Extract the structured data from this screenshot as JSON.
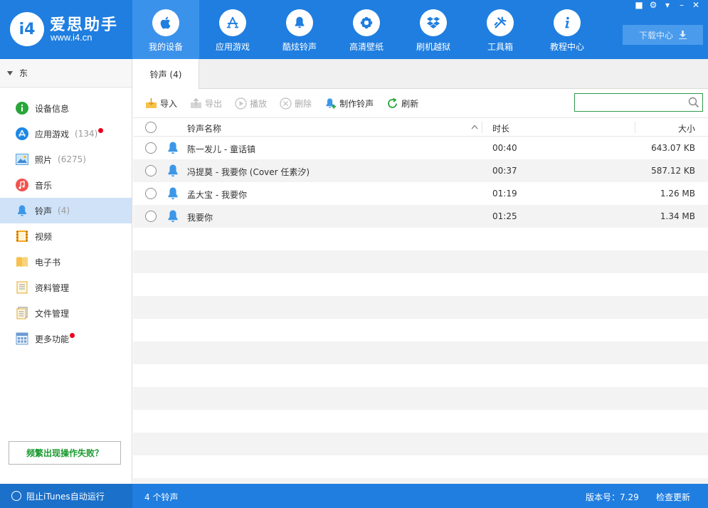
{
  "app": {
    "name": "爱思助手",
    "url": "www.i4.cn",
    "logo_text": "i4"
  },
  "nav": [
    {
      "label": "我的设备",
      "icon": "apple-icon"
    },
    {
      "label": "应用游戏",
      "icon": "appstore-icon"
    },
    {
      "label": "酷炫铃声",
      "icon": "bell-icon"
    },
    {
      "label": "高清壁纸",
      "icon": "flower-icon"
    },
    {
      "label": "刷机越狱",
      "icon": "dropbox-icon"
    },
    {
      "label": "工具箱",
      "icon": "tools-icon"
    },
    {
      "label": "教程中心",
      "icon": "info-icon"
    }
  ],
  "download_center": "下载中心",
  "sidebar": {
    "device_name": "东",
    "items": [
      {
        "label": "设备信息",
        "count": ""
      },
      {
        "label": "应用游戏",
        "count": "(134)"
      },
      {
        "label": "照片",
        "count": "(6275)"
      },
      {
        "label": "音乐",
        "count": ""
      },
      {
        "label": "铃声",
        "count": "(4)"
      },
      {
        "label": "视频",
        "count": ""
      },
      {
        "label": "电子书",
        "count": ""
      },
      {
        "label": "资料管理",
        "count": ""
      },
      {
        "label": "文件管理",
        "count": ""
      },
      {
        "label": "更多功能",
        "count": ""
      }
    ],
    "help_label": "频繁出现操作失败？"
  },
  "tab": {
    "label": "铃声 (4)"
  },
  "toolbar": {
    "import": "导入",
    "export": "导出",
    "play": "播放",
    "delete": "删除",
    "make": "制作铃声",
    "refresh": "刷新",
    "search_placeholder": ""
  },
  "table": {
    "headers": {
      "name": "铃声名称",
      "duration": "时长",
      "size": "大小"
    },
    "rows": [
      {
        "name": "陈一发儿 - 童话镇",
        "duration": "00:40",
        "size": "643.07 KB"
      },
      {
        "name": "冯提莫 - 我要你 (Cover 任素汐)",
        "duration": "00:37",
        "size": "587.12 KB"
      },
      {
        "name": "孟大宝 - 我要你",
        "duration": "01:19",
        "size": "1.26 MB"
      },
      {
        "name": "我要你",
        "duration": "01:25",
        "size": "1.34 MB"
      }
    ]
  },
  "status": {
    "itunes_block": "阻止iTunes自动运行",
    "count": "4 个铃声",
    "version": "版本号：7.29",
    "update": "检查更新"
  },
  "colors": {
    "primary": "#1f7ee0",
    "active_side": "#cfe2f7",
    "green": "#2e9a4a",
    "red_dot": "#e8001c"
  }
}
